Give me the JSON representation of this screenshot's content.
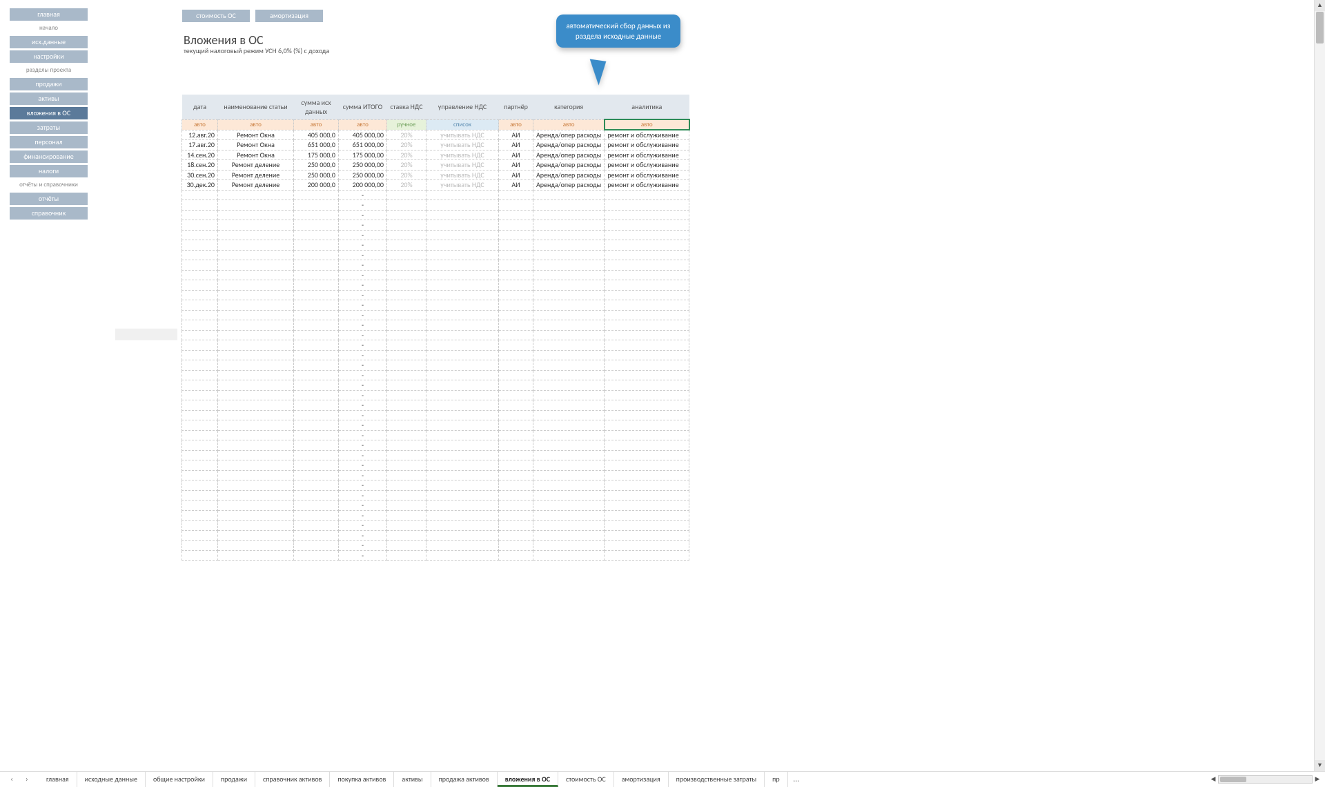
{
  "sidebar": {
    "items": [
      {
        "label": "главная",
        "type": "btn"
      },
      {
        "label": "начало",
        "type": "lbl"
      },
      {
        "label": "исх.данные",
        "type": "btn"
      },
      {
        "label": "настройки",
        "type": "btn"
      },
      {
        "label": "разделы проекта",
        "type": "lbl"
      },
      {
        "label": "продажи",
        "type": "btn"
      },
      {
        "label": "активы",
        "type": "btn"
      },
      {
        "label": "вложения в ОС",
        "type": "btn",
        "active": true
      },
      {
        "label": "затраты",
        "type": "btn"
      },
      {
        "label": "персонал",
        "type": "btn"
      },
      {
        "label": "финансирование",
        "type": "btn"
      },
      {
        "label": "налоги",
        "type": "btn"
      },
      {
        "label": "отчёты и справочники",
        "type": "lbl"
      },
      {
        "label": "отчёты",
        "type": "btn"
      },
      {
        "label": "справочник",
        "type": "btn"
      }
    ]
  },
  "topbuttons": [
    "стоимость ОС",
    "амортизация"
  ],
  "title": "Вложения в ОС",
  "subtitle": "текущий налоговый режим УСН 6,0% (%) с дохода",
  "callout": "автоматический сбор данных из раздела исходные данные",
  "table": {
    "headers": [
      "дата",
      "наименование статьи",
      "сумма исх данных",
      "сумма ИТОГО",
      "ставка НДС",
      "управление НДС",
      "партнёр",
      "категория",
      "аналитика"
    ],
    "modes": [
      "авто",
      "авто",
      "авто",
      "авто",
      "ручное",
      "список",
      "авто",
      "авто",
      "авто"
    ],
    "mode_kinds": [
      "auto",
      "auto",
      "auto",
      "auto",
      "manual",
      "list",
      "auto",
      "auto",
      "auto"
    ],
    "selected_mode_col": 8,
    "rows": [
      {
        "date": "12.авг.20",
        "name": "Ремонт Окна",
        "sum1": "405 000,0",
        "sum2": "405 000,00",
        "vat": "20%",
        "vatc": "учитывать НДС",
        "part": "АИ",
        "cat": "Аренда/опер расходы",
        "anal": "ремонт и обслуживание"
      },
      {
        "date": "17.авг.20",
        "name": "Ремонт Окна",
        "sum1": "651 000,0",
        "sum2": "651 000,00",
        "vat": "20%",
        "vatc": "учитывать НДС",
        "part": "АИ",
        "cat": "Аренда/опер расходы",
        "anal": "ремонт и обслуживание"
      },
      {
        "date": "14.сен.20",
        "name": "Ремонт Окна",
        "sum1": "175 000,0",
        "sum2": "175 000,00",
        "vat": "20%",
        "vatc": "учитывать НДС",
        "part": "АИ",
        "cat": "Аренда/опер расходы",
        "anal": "ремонт и обслуживание"
      },
      {
        "date": "18.сен.20",
        "name": "Ремонт деление",
        "sum1": "250 000,0",
        "sum2": "250 000,00",
        "vat": "20%",
        "vatc": "учитывать НДС",
        "part": "АИ",
        "cat": "Аренда/опер расходы",
        "anal": "ремонт и обслуживание"
      },
      {
        "date": "30.сен.20",
        "name": "Ремонт деление",
        "sum1": "250 000,0",
        "sum2": "250 000,00",
        "vat": "20%",
        "vatc": "учитывать НДС",
        "part": "АИ",
        "cat": "Аренда/опер расходы",
        "anal": "ремонт и обслуживание"
      },
      {
        "date": "30.дек.20",
        "name": "Ремонт деление",
        "sum1": "200 000,0",
        "sum2": "200 000,00",
        "vat": "20%",
        "vatc": "учитывать НДС",
        "part": "АИ",
        "cat": "Аренда/опер расходы",
        "anal": "ремонт и обслуживание"
      }
    ],
    "empty_rows": 37,
    "empty_placeholder": "-"
  },
  "sheet_tabs": {
    "prev": "‹",
    "next": "›",
    "tabs": [
      "главная",
      "исходные данные",
      "общие настройки",
      "продажи",
      "справочник активов",
      "покупка активов",
      "активы",
      "продажа активов",
      "вложения в ОС",
      "стоимость ОС",
      "амортизация",
      "производственные затраты",
      "пр"
    ],
    "active_index": 8,
    "more": "…"
  }
}
